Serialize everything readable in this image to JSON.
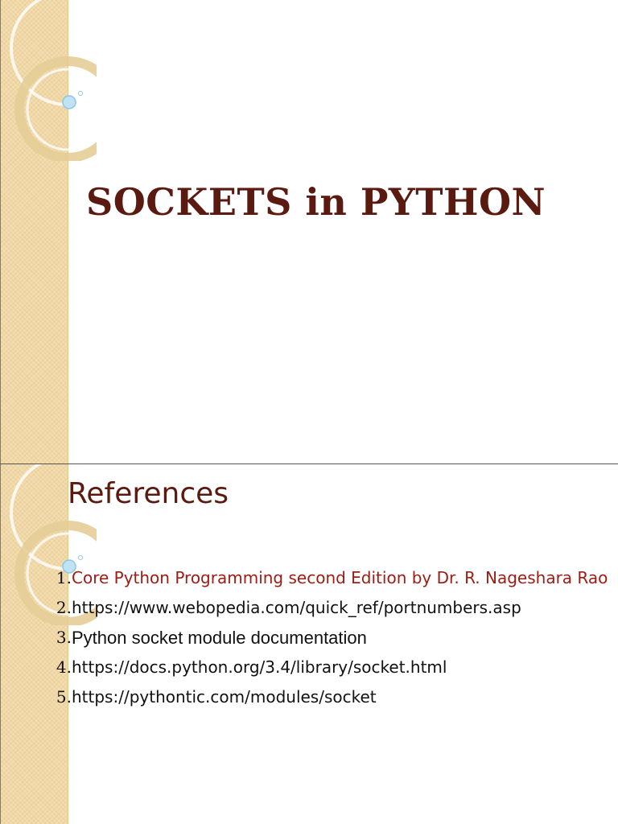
{
  "slide1": {
    "title": "SOCKETS in PYTHON"
  },
  "slide2": {
    "heading": "References",
    "references": [
      {
        "number": "1.",
        "text": "Core Python Programming second Edition by Dr. R. Nageshara Rao"
      },
      {
        "number": "2.",
        "text": "https://www.webopedia.com/quick_ref/portnumbers.asp"
      },
      {
        "number": "3.",
        "text": "Python socket module documentation"
      },
      {
        "number": "4.",
        "text": "https://docs.python.org/3.4/library/socket.html"
      },
      {
        "number": "5.",
        "text": "https://pythontic.com/modules/socket"
      }
    ]
  },
  "colors": {
    "title": "#5b1a10",
    "highlight_reference": "#9c1c14",
    "band": "#f3ddb0"
  }
}
